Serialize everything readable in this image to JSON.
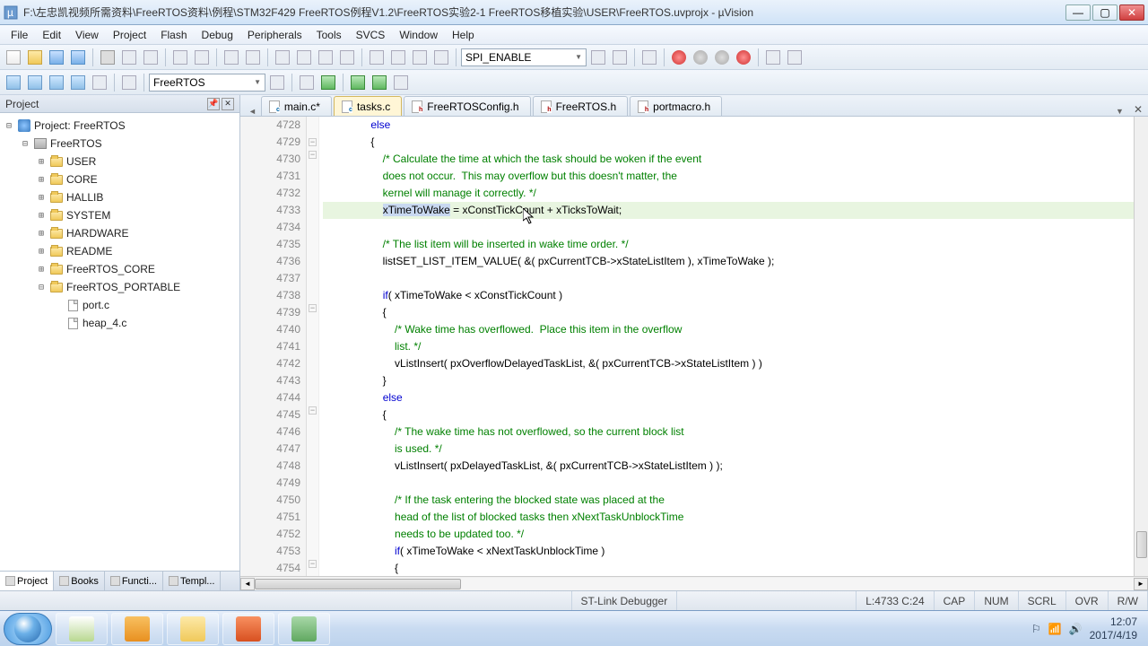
{
  "window": {
    "title": "F:\\左忠凯视频所需资料\\FreeRTOS资料\\例程\\STM32F429 FreeRTOS例程V1.2\\FreeRTOS实验2-1 FreeRTOS移植实验\\USER\\FreeRTOS.uvprojx - µVision"
  },
  "menu": {
    "items": [
      "File",
      "Edit",
      "View",
      "Project",
      "Flash",
      "Debug",
      "Peripherals",
      "Tools",
      "SVCS",
      "Window",
      "Help"
    ]
  },
  "toolbar1": {
    "search": "SPI_ENABLE"
  },
  "toolbar2": {
    "target": "FreeRTOS"
  },
  "project": {
    "panel_title": "Project",
    "root": "Project: FreeRTOS",
    "target": "FreeRTOS",
    "groups": [
      "USER",
      "CORE",
      "HALLIB",
      "SYSTEM",
      "HARDWARE",
      "README",
      "FreeRTOS_CORE",
      "FreeRTOS_PORTABLE"
    ],
    "portable_files": [
      "port.c",
      "heap_4.c"
    ],
    "tabs": [
      "Project",
      "Books",
      "Functi...",
      "Templ..."
    ]
  },
  "editor": {
    "tabs": [
      {
        "name": "main.c*",
        "kind": "c",
        "active": false
      },
      {
        "name": "tasks.c",
        "kind": "c",
        "active": true
      },
      {
        "name": "FreeRTOSConfig.h",
        "kind": "h",
        "active": false
      },
      {
        "name": "FreeRTOS.h",
        "kind": "h",
        "active": false
      },
      {
        "name": "portmacro.h",
        "kind": "h",
        "active": false
      }
    ],
    "first_line": 4728,
    "lines": [
      {
        "n": 4728,
        "t": "                else",
        "fold": ""
      },
      {
        "n": 4729,
        "t": "                {",
        "fold": "-"
      },
      {
        "n": 4730,
        "t": "                    /* Calculate the time at which the task should be woken if the event",
        "c": true,
        "fold": "-"
      },
      {
        "n": 4731,
        "t": "                    does not occur.  This may overflow but this doesn't matter, the",
        "c": true
      },
      {
        "n": 4732,
        "t": "                    kernel will manage it correctly. */",
        "c": true
      },
      {
        "n": 4733,
        "t": "                    xTimeToWake = xConstTickCount + xTicksToWait;",
        "hl": true,
        "seltoken": "xTimeToWake"
      },
      {
        "n": 4734,
        "t": ""
      },
      {
        "n": 4735,
        "t": "                    /* The list item will be inserted in wake time order. */",
        "c": true
      },
      {
        "n": 4736,
        "t": "                    listSET_LIST_ITEM_VALUE( &( pxCurrentTCB->xStateListItem ), xTimeToWake );"
      },
      {
        "n": 4737,
        "t": ""
      },
      {
        "n": 4738,
        "t": "                    if( xTimeToWake < xConstTickCount )"
      },
      {
        "n": 4739,
        "t": "                    {",
        "fold": "-"
      },
      {
        "n": 4740,
        "t": "                        /* Wake time has overflowed.  Place this item in the overflow",
        "c": true
      },
      {
        "n": 4741,
        "t": "                        list. */",
        "c": true
      },
      {
        "n": 4742,
        "t": "                        vListInsert( pxOverflowDelayedTaskList, &( pxCurrentTCB->xStateListItem ) )"
      },
      {
        "n": 4743,
        "t": "                    }"
      },
      {
        "n": 4744,
        "t": "                    else"
      },
      {
        "n": 4745,
        "t": "                    {",
        "fold": "-"
      },
      {
        "n": 4746,
        "t": "                        /* The wake time has not overflowed, so the current block list",
        "c": true
      },
      {
        "n": 4747,
        "t": "                        is used. */",
        "c": true
      },
      {
        "n": 4748,
        "t": "                        vListInsert( pxDelayedTaskList, &( pxCurrentTCB->xStateListItem ) );"
      },
      {
        "n": 4749,
        "t": ""
      },
      {
        "n": 4750,
        "t": "                        /* If the task entering the blocked state was placed at the",
        "c": true
      },
      {
        "n": 4751,
        "t": "                        head of the list of blocked tasks then xNextTaskUnblockTime",
        "c": true
      },
      {
        "n": 4752,
        "t": "                        needs to be updated too. */",
        "c": true
      },
      {
        "n": 4753,
        "t": "                        if( xTimeToWake < xNextTaskUnblockTime )"
      },
      {
        "n": 4754,
        "t": "                        {",
        "fold": "-"
      }
    ]
  },
  "status": {
    "debugger": "ST-Link Debugger",
    "pos": "L:4733 C:24",
    "caps": "CAP",
    "num": "NUM",
    "scrl": "SCRL",
    "ovr": "OVR",
    "rw": "R/W"
  },
  "tray": {
    "time": "12:07",
    "date": "2017/4/19"
  }
}
